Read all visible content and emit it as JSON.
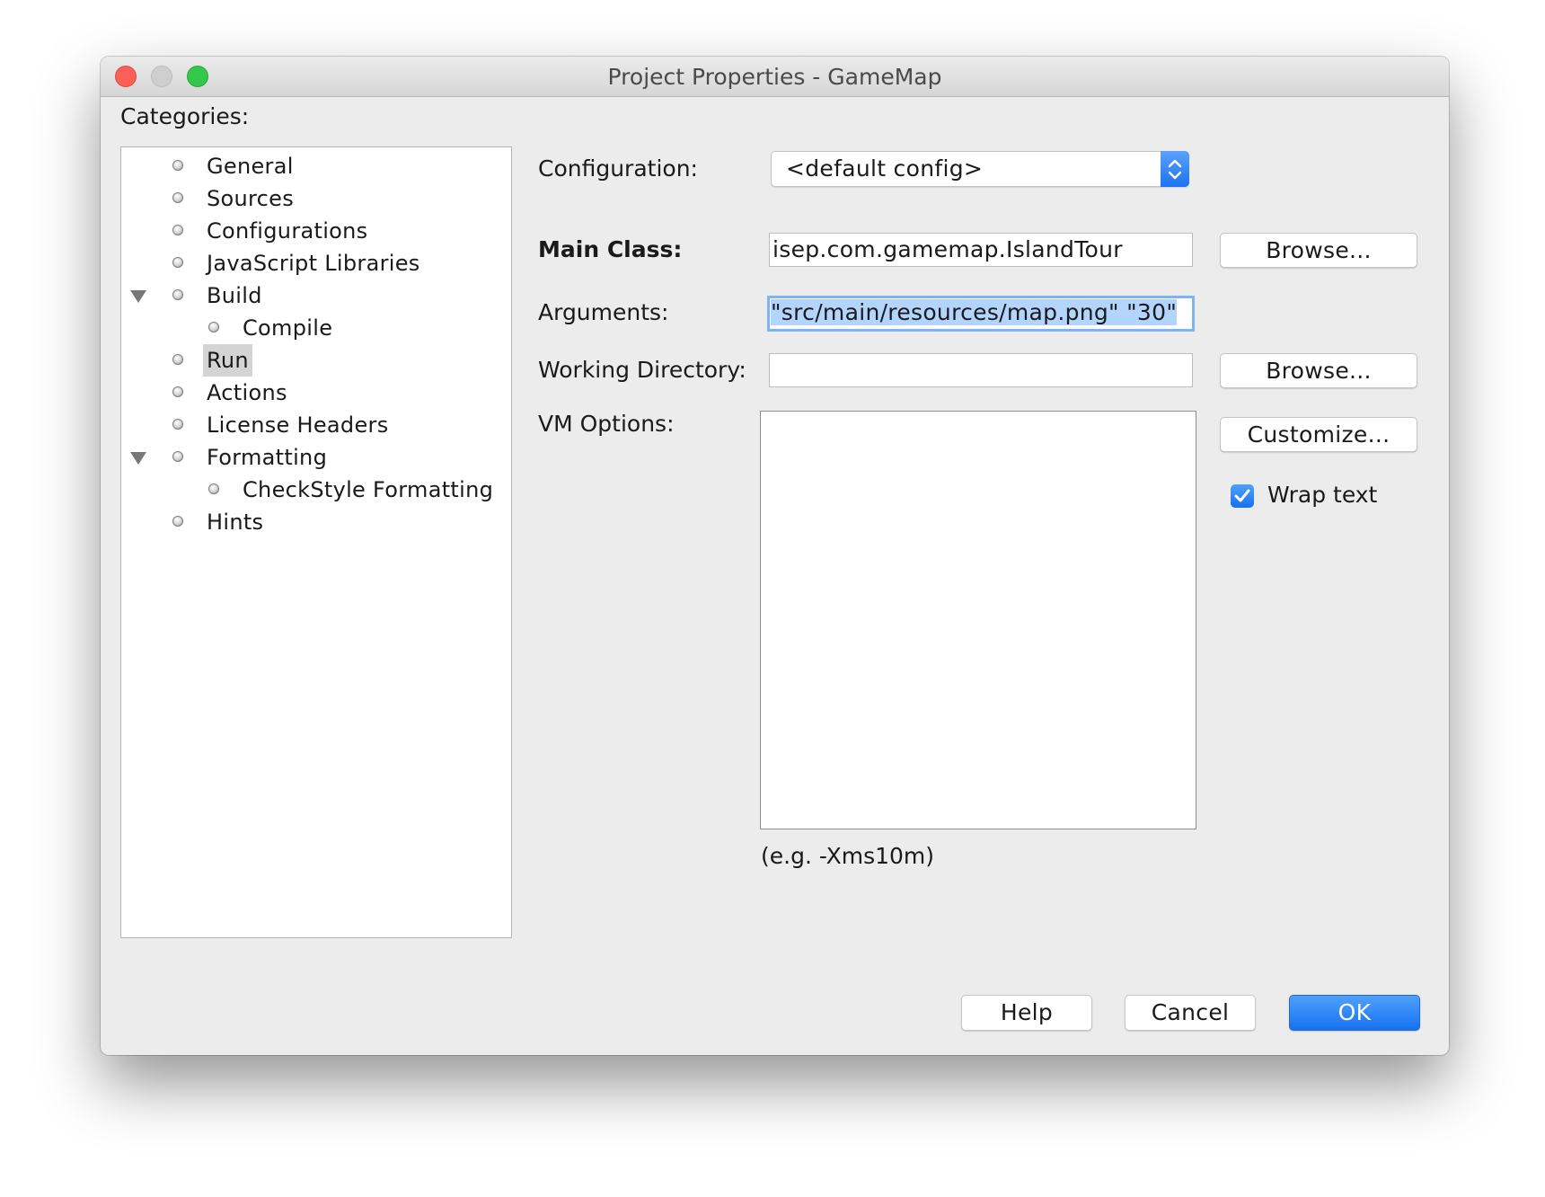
{
  "window": {
    "title": "Project Properties - GameMap"
  },
  "categories": {
    "label": "Categories:",
    "items": [
      {
        "label": "General"
      },
      {
        "label": "Sources"
      },
      {
        "label": "Configurations"
      },
      {
        "label": "JavaScript Libraries"
      },
      {
        "label": "Build",
        "expanded": true
      },
      {
        "label": "Compile"
      },
      {
        "label": "Run",
        "selected": true
      },
      {
        "label": "Actions"
      },
      {
        "label": "License Headers"
      },
      {
        "label": "Formatting",
        "expanded": true
      },
      {
        "label": "CheckStyle Formatting"
      },
      {
        "label": "Hints"
      }
    ]
  },
  "form": {
    "configuration_label": "Configuration:",
    "configuration_value": "<default config>",
    "main_class_label": "Main Class:",
    "main_class_value": "isep.com.gamemap.IslandTour",
    "browse_label": "Browse...",
    "arguments_label": "Arguments:",
    "arguments_value": "\"src/main/resources/map.png\" \"30\"",
    "working_dir_label": "Working Directory:",
    "working_dir_value": "",
    "vm_options_label": "VM Options:",
    "vm_options_value": "",
    "customize_label": "Customize...",
    "wrap_text_label": "Wrap text",
    "wrap_text_checked": true,
    "vm_hint": "(e.g. -Xms10m)"
  },
  "buttons": {
    "help": "Help",
    "cancel": "Cancel",
    "ok": "OK"
  },
  "colors": {
    "accent": "#1771f0",
    "close": "#fc5f57",
    "minimize": "#cfcfcf",
    "zoom": "#34c84a"
  }
}
